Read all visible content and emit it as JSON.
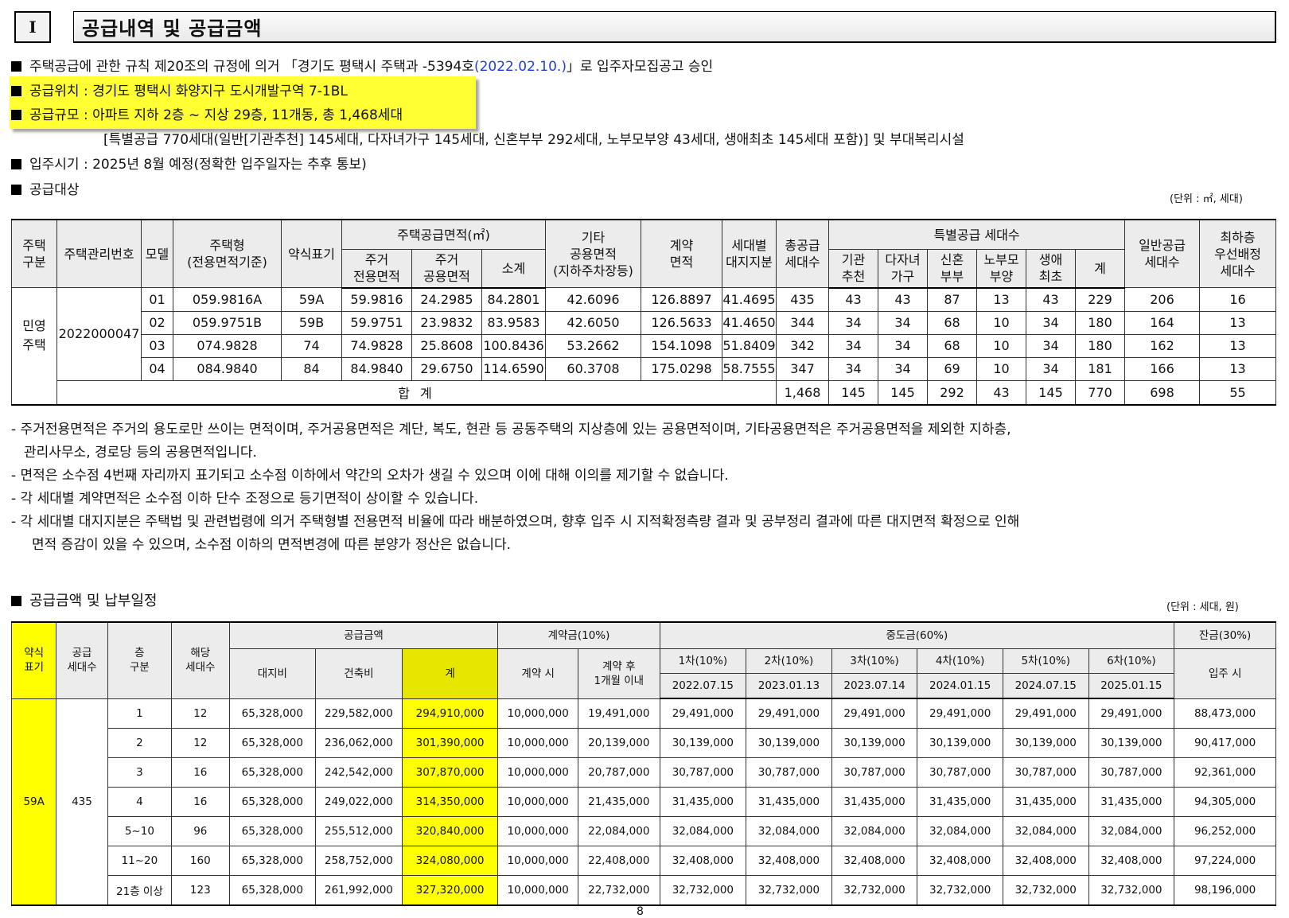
{
  "section": {
    "number": "I",
    "title": "공급내역 및 공급금액"
  },
  "info": {
    "line1_prefix": "주택공급에 관한 규칙 제20조의 규정에 의거 「경기도 평택시 주택과 -5394호",
    "line1_date": "(2022.02.10.)",
    "line1_suffix": "」로 입주자모집공고 승인",
    "location": "공급위치 : 경기도 평택시 화양지구 도시개발구역 7-1BL",
    "scale": "공급규모 : 아파트 지하 2층 ~ 지상 29층, 11개동, 총 1,468세대",
    "scale_detail": "[특별공급 770세대(일반[기관추천] 145세대, 다자녀가구 145세대, 신혼부부 292세대, 노부모부양 43세대, 생애최초 145세대 포함)] 및 부대복리시설",
    "move_in": "입주시기 : 2025년 8월 예정(정확한 입주일자는 추후 통보)",
    "target_heading": "공급대상",
    "target_unit": "(단위 : ㎡, 세대)"
  },
  "table1": {
    "headers": {
      "house_type": "주택\n구분",
      "mgmt_no": "주택관리번호",
      "model": "모델",
      "housing_type": "주택형\n(전용면적기준)",
      "abbr": "약식표기",
      "area_group": "주택공급면적(㎡)",
      "exclusive": "주거\n전용면적",
      "common": "주거\n공용면적",
      "subtotal": "소계",
      "other_common": "기타\n공용면적\n(지하주차장등)",
      "contract_area": "계약\n면적",
      "land_share": "세대별\n대지지분",
      "total_supply": "총공급\n세대수",
      "special_group": "특별공급 세대수",
      "agency": "기관\n추천",
      "multi_child": "다자녀\n가구",
      "newlywed": "신혼\n부부",
      "elderly": "노부모\n부양",
      "first_time": "생애\n최초",
      "special_total": "계",
      "general_supply": "일반공급\n세대수",
      "top_floor": "최하층\n우선배정\n세대수"
    },
    "house_category": "민영\n주택",
    "mgmt_number": "2022000047",
    "rows": [
      {
        "model": "01",
        "type": "059.9816A",
        "abbr": "59A",
        "exclusive": "59.9816",
        "common": "24.2985",
        "subtotal": "84.2801",
        "other": "42.6096",
        "contract": "126.8897",
        "land": "41.4695",
        "total": "435",
        "agency": "43",
        "multi": "43",
        "newlywed": "87",
        "elderly": "13",
        "first": "43",
        "sp_total": "229",
        "general": "206",
        "top": "16"
      },
      {
        "model": "02",
        "type": "059.9751B",
        "abbr": "59B",
        "exclusive": "59.9751",
        "common": "23.9832",
        "subtotal": "83.9583",
        "other": "42.6050",
        "contract": "126.5633",
        "land": "41.4650",
        "total": "344",
        "agency": "34",
        "multi": "34",
        "newlywed": "68",
        "elderly": "10",
        "first": "34",
        "sp_total": "180",
        "general": "164",
        "top": "13"
      },
      {
        "model": "03",
        "type": "074.9828",
        "abbr": "74",
        "exclusive": "74.9828",
        "common": "25.8608",
        "subtotal": "100.8436",
        "other": "53.2662",
        "contract": "154.1098",
        "land": "51.8409",
        "total": "342",
        "agency": "34",
        "multi": "34",
        "newlywed": "68",
        "elderly": "10",
        "first": "34",
        "sp_total": "180",
        "general": "162",
        "top": "13"
      },
      {
        "model": "04",
        "type": "084.9840",
        "abbr": "84",
        "exclusive": "84.9840",
        "common": "29.6750",
        "subtotal": "114.6590",
        "other": "60.3708",
        "contract": "175.0298",
        "land": "58.7555",
        "total": "347",
        "agency": "34",
        "multi": "34",
        "newlywed": "69",
        "elderly": "10",
        "first": "34",
        "sp_total": "181",
        "general": "166",
        "top": "13"
      }
    ],
    "total_row": {
      "label": "합 계",
      "total": "1,468",
      "agency": "145",
      "multi": "145",
      "newlywed": "292",
      "elderly": "43",
      "first": "145",
      "sp_total": "770",
      "general": "698",
      "top": "55"
    }
  },
  "notes": [
    "- 주거전용면적은 주거의 용도로만 쓰이는 면적이며, 주거공용면적은 계단, 복도, 현관 등 공동주택의 지상층에 있는 공용면적이며, 기타공용면적은 주거공용면적을 제외한 지하층,",
    "관리사무소, 경로당 등의 공용면적입니다.",
    "- 면적은 소수점 4번째 자리까지 표기되고 소수점 이하에서 약간의 오차가 생길 수 있으며 이에 대해 이의를 제기할 수 없습니다.",
    "- 각 세대별 계약면적은 소수점 이하 단수 조정으로 등기면적이 상이할 수 있습니다.",
    "- 각 세대별 대지지분은 주택법 및 관련법령에 의거 주택형별 전용면적 비율에 따라 배분하였으며, 향후 입주 시 지적확정측량 결과 및 공부정리 결과에 따른 대지면적 확정으로 인해",
    "면적 증감이 있을 수 있으며, 소수점 이하의 면적변경에 따른 분양가 정산은 없습니다."
  ],
  "price": {
    "heading": "공급금액 및 납부일정",
    "unit": "(단위 : 세대, 원)",
    "headers": {
      "abbr": "약식\n표기",
      "supply_units": "공급\n세대수",
      "floor": "층\n구분",
      "units": "해당\n세대수",
      "supply_amount": "공급금액",
      "land": "대지비",
      "building": "건축비",
      "sum": "계",
      "deposit_group": "계약금(10%)",
      "deposit_at": "계약 시",
      "deposit_after": "계약 후\n1개월 이내",
      "interim_group": "중도금(60%)",
      "interim": [
        {
          "label": "1차(10%)",
          "date": "2022.07.15"
        },
        {
          "label": "2차(10%)",
          "date": "2023.01.13"
        },
        {
          "label": "3차(10%)",
          "date": "2023.07.14"
        },
        {
          "label": "4차(10%)",
          "date": "2024.01.15"
        },
        {
          "label": "5차(10%)",
          "date": "2024.07.15"
        },
        {
          "label": "6차(10%)",
          "date": "2025.01.15"
        }
      ],
      "balance_group": "잔금(30%)",
      "balance_at": "입주 시"
    },
    "abbr_value": "59A",
    "supply_units_value": "435",
    "rows": [
      {
        "floor": "1",
        "units": "12",
        "land": "65,328,000",
        "building": "229,582,000",
        "sum": "294,910,000",
        "dep1": "10,000,000",
        "dep2": "19,491,000",
        "interim": [
          "29,491,000",
          "29,491,000",
          "29,491,000",
          "29,491,000",
          "29,491,000",
          "29,491,000"
        ],
        "balance": "88,473,000"
      },
      {
        "floor": "2",
        "units": "12",
        "land": "65,328,000",
        "building": "236,062,000",
        "sum": "301,390,000",
        "dep1": "10,000,000",
        "dep2": "20,139,000",
        "interim": [
          "30,139,000",
          "30,139,000",
          "30,139,000",
          "30,139,000",
          "30,139,000",
          "30,139,000"
        ],
        "balance": "90,417,000"
      },
      {
        "floor": "3",
        "units": "16",
        "land": "65,328,000",
        "building": "242,542,000",
        "sum": "307,870,000",
        "dep1": "10,000,000",
        "dep2": "20,787,000",
        "interim": [
          "30,787,000",
          "30,787,000",
          "30,787,000",
          "30,787,000",
          "30,787,000",
          "30,787,000"
        ],
        "balance": "92,361,000"
      },
      {
        "floor": "4",
        "units": "16",
        "land": "65,328,000",
        "building": "249,022,000",
        "sum": "314,350,000",
        "dep1": "10,000,000",
        "dep2": "21,435,000",
        "interim": [
          "31,435,000",
          "31,435,000",
          "31,435,000",
          "31,435,000",
          "31,435,000",
          "31,435,000"
        ],
        "balance": "94,305,000"
      },
      {
        "floor": "5~10",
        "units": "96",
        "land": "65,328,000",
        "building": "255,512,000",
        "sum": "320,840,000",
        "dep1": "10,000,000",
        "dep2": "22,084,000",
        "interim": [
          "32,084,000",
          "32,084,000",
          "32,084,000",
          "32,084,000",
          "32,084,000",
          "32,084,000"
        ],
        "balance": "96,252,000"
      },
      {
        "floor": "11~20",
        "units": "160",
        "land": "65,328,000",
        "building": "258,752,000",
        "sum": "324,080,000",
        "dep1": "10,000,000",
        "dep2": "22,408,000",
        "interim": [
          "32,408,000",
          "32,408,000",
          "32,408,000",
          "32,408,000",
          "32,408,000",
          "32,408,000"
        ],
        "balance": "97,224,000"
      },
      {
        "floor": "21층 이상",
        "units": "123",
        "land": "65,328,000",
        "building": "261,992,000",
        "sum": "327,320,000",
        "dep1": "10,000,000",
        "dep2": "22,732,000",
        "interim": [
          "32,732,000",
          "32,732,000",
          "32,732,000",
          "32,732,000",
          "32,732,000",
          "32,732,000"
        ],
        "balance": "98,196,000"
      }
    ]
  },
  "page_number": "8",
  "colors": {
    "highlight": "#ffff33",
    "blue_text": "#1f3fd6",
    "header_bg": "#ececec"
  }
}
